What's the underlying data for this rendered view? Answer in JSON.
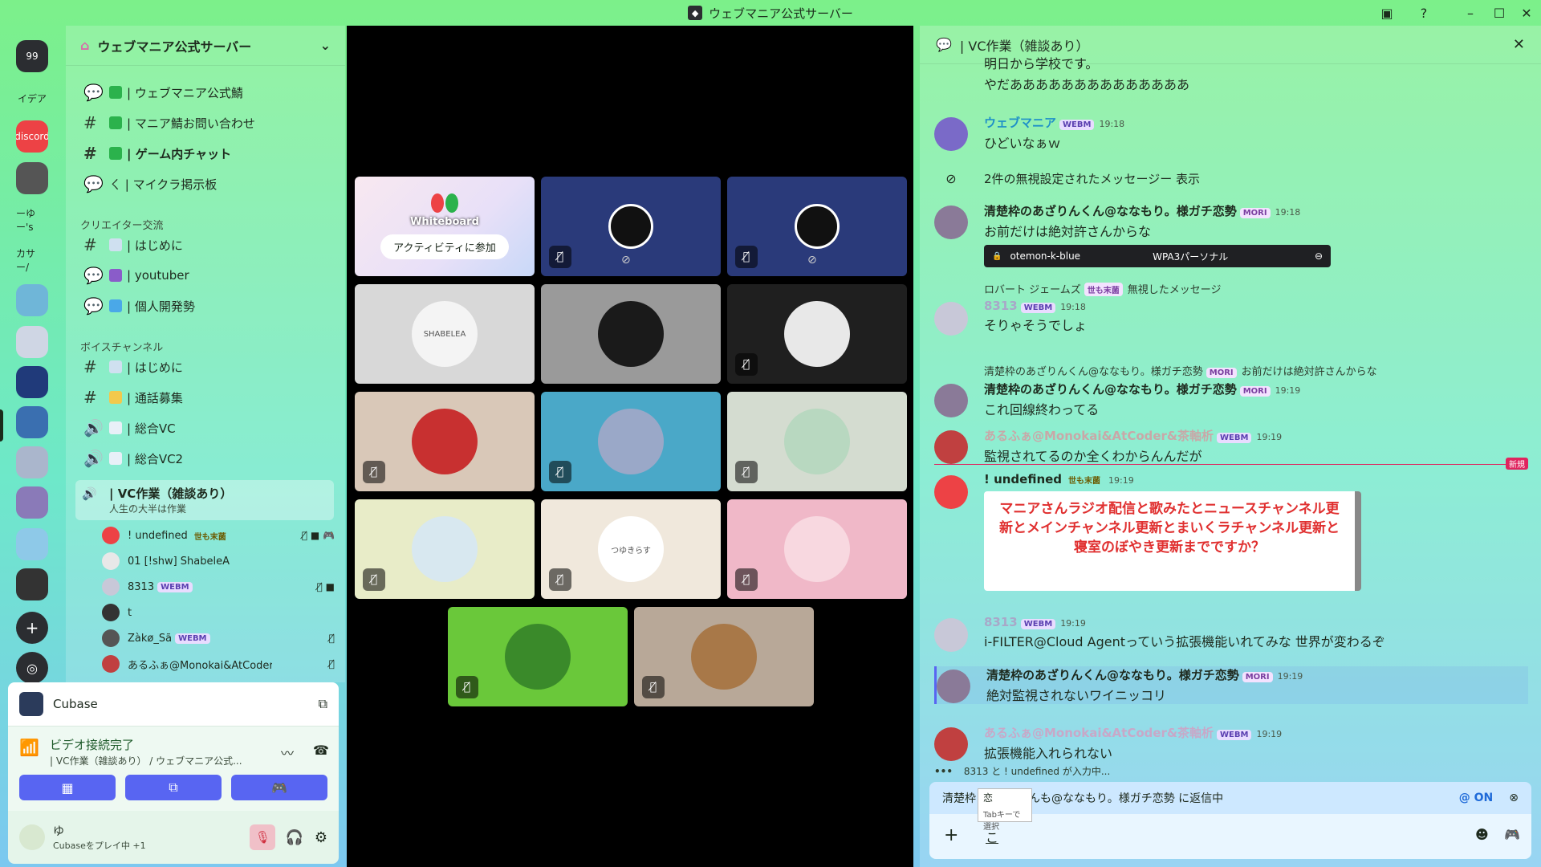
{
  "window": {
    "title": "ウェブマニア公式サーバー"
  },
  "colors": {
    "accent": "#5865f2",
    "discord_red": "#ed4245",
    "new_marker": "#e0245e"
  },
  "rail": {
    "items": [
      {
        "label": "99",
        "bg": "#2b2d31"
      },
      {
        "label": "イデア",
        "bg": "transparent"
      },
      {
        "label": "discord",
        "bg": "#ed4245"
      },
      {
        "label": "",
        "bg": "#555"
      },
      {
        "label": "ーゆー's",
        "bg": "transparent"
      },
      {
        "label": "カサー/",
        "bg": "transparent"
      },
      {
        "label": "",
        "bg": "#6fb6d8"
      },
      {
        "label": "",
        "bg": "#cfd6e4"
      },
      {
        "label": "",
        "bg": "#203a7a"
      },
      {
        "label": "",
        "bg": "#3a6fb0"
      },
      {
        "label": "",
        "bg": "#aab6cc"
      },
      {
        "label": "",
        "bg": "#8a7ab8"
      },
      {
        "label": "",
        "bg": "#8ec9e8"
      },
      {
        "label": "",
        "bg": "#333"
      }
    ]
  },
  "server": {
    "name": "ウェブマニア公式サーバー",
    "channels_top": [
      {
        "label": "| ウェブマニア公式鯖",
        "type": "forum",
        "emoji_color": "#2bb24c"
      },
      {
        "label": "| マニア鯖お問い合わせ",
        "type": "text",
        "emoji_color": "#2bb24c"
      },
      {
        "label": "| ゲーム内チャット",
        "type": "text",
        "emoji_color": "#2bb24c",
        "bold": true
      },
      {
        "label": "ㄑ | マイクラ掲示板",
        "type": "forum",
        "emoji_color": ""
      }
    ],
    "category_creator": "クリエイター交流",
    "channels_creator": [
      {
        "label": "| はじめに",
        "type": "text",
        "emoji_color": "#cfe0f0"
      },
      {
        "label": "| youtuber",
        "type": "forum",
        "emoji_color": "#8a5cc9"
      },
      {
        "label": "| 個人開発勢",
        "type": "forum",
        "emoji_color": "#4aa8e8"
      }
    ],
    "category_voice": "ボイスチャンネル",
    "channels_voice": [
      {
        "label": "| はじめに",
        "type": "text",
        "emoji_color": "#cfe0f0"
      },
      {
        "label": "| 通話募集",
        "type": "text",
        "emoji_color": "#f2c94c"
      },
      {
        "label": "| 総合VC",
        "type": "voice",
        "emoji_color": "#e8f0f8"
      },
      {
        "label": "| 総合VC2",
        "type": "voice",
        "emoji_color": "#e8f0f8"
      }
    ],
    "active_vc": {
      "label": "| VC作業（雑談あり）",
      "status": "人生の大半は作業"
    },
    "vc_users": [
      {
        "name": "! undefined",
        "badge": "世も末菌",
        "badge_type": "yo",
        "av": "#ed4245",
        "icons": "🎙̸ ■ 🎮"
      },
      {
        "name": "01 [!shw] ShabeleA",
        "badge": "",
        "badge_type": "",
        "av": "#e8e8e8",
        "icons": ""
      },
      {
        "name": "8313",
        "badge": "WEBM",
        "badge_type": "webm",
        "av": "#c8c8d8",
        "icons": "🎙̸ ■"
      },
      {
        "name": "t",
        "badge": "",
        "badge_type": "",
        "av": "#333",
        "icons": ""
      },
      {
        "name": "Zàkø_Sã",
        "badge": "WEBM",
        "badge_type": "webm",
        "av": "#555",
        "icons": "🎙̸"
      },
      {
        "name": "あるふぁ@Monokai&AtCoder&茶軸...",
        "badge": "",
        "badge_type": "",
        "av": "#c04040",
        "icons": "🎙̸"
      }
    ]
  },
  "activity": {
    "name": "Cubase"
  },
  "voice_panel": {
    "status": "ビデオ接続完了",
    "location": "| VC作業（雑談あり） / ウェブマニア公式..."
  },
  "user_panel": {
    "name": "ゆ",
    "activity": "Cubaseをプレイ中 +1"
  },
  "stage": {
    "whiteboard_label": "Whiteboard",
    "join_activity": "アクティビティに参加",
    "tiles": [
      {
        "bg": "#2a3a7a",
        "kind": "obs"
      },
      {
        "bg": "#2a3a7a",
        "kind": "obs"
      },
      {
        "bg": "#d8d8d8",
        "ava": "#f4f4f4",
        "kind": "avatar",
        "label": "SHABELEA"
      },
      {
        "bg": "#9a9a9a",
        "ava": "#1a1a1a",
        "kind": "avatar",
        "label": ""
      },
      {
        "bg": "#1f1f1f",
        "ava": "#e8e8e8",
        "kind": "avatar",
        "label": ""
      },
      {
        "bg": "#d9c8b8",
        "ava": "#c83030",
        "kind": "avatar",
        "label": ""
      },
      {
        "bg": "#4aa8c8",
        "ava": "#9aa8c8",
        "kind": "avatar",
        "label": ""
      },
      {
        "bg": "#d4dcd0",
        "ava": "#b8d8c0",
        "kind": "avatar",
        "label": ""
      },
      {
        "bg": "#e8ecc8",
        "ava": "#d8e8f0",
        "kind": "avatar",
        "label": ""
      },
      {
        "bg": "#f0e8dc",
        "ava": "#ffffff",
        "kind": "avatar",
        "label": "つゆきらす"
      },
      {
        "bg": "#f0b8c8",
        "ava": "#f8d8e0",
        "kind": "avatar",
        "label": ""
      },
      {
        "bg": "#6ac83a",
        "ava": "#3a8a2a",
        "kind": "avatar",
        "label": ""
      },
      {
        "bg": "#b8a898",
        "ava": "#a87848",
        "kind": "avatar",
        "label": ""
      }
    ]
  },
  "chat": {
    "header": "| VC作業（雑談あり）",
    "messages": [
      {
        "kind": "cont",
        "text1": "明日から学校です。",
        "text2": "やだああああああああああああああ"
      },
      {
        "kind": "msg",
        "name": "ウェブマニア",
        "name_color": "#1e90c8",
        "badge": "WEBM",
        "badge_type": "webm",
        "time": "19:18",
        "text": "ひどいなぁｗ",
        "av": "#7a6ac8"
      },
      {
        "kind": "blocked",
        "text": "2件の無視設定されたメッセージー 表示"
      },
      {
        "kind": "msg",
        "name": "清楚枠のあざりんくん@ななもり。様ガチ恋勢",
        "name_color": "#1e2a1e",
        "badge": "MORI",
        "badge_type": "mori",
        "time": "19:18",
        "text": "お前だけは絶対許さんからな",
        "av": "#8a7a98",
        "wifi_name": "otemon-k-blue",
        "wifi_sec": "WPA3パーソナル"
      },
      {
        "kind": "msg",
        "reply_name": "ロバート ジェームズ",
        "reply_badge": "世も末菌",
        "reply_text": "無視したメッセージ",
        "name": "8313",
        "name_color": "#a8a8c8",
        "badge": "WEBM",
        "badge_type": "webm",
        "time": "19:18",
        "text": "そりゃそうでしょ",
        "av": "#c8c8d8"
      },
      {
        "kind": "msg",
        "reply_name": "清楚枠のあざりんくん@ななもり。様ガチ恋勢",
        "reply_badge": "MORI",
        "reply_text": "お前だけは絶対許さんからな",
        "name": "清楚枠のあざりんくん@ななもり。様ガチ恋勢",
        "name_color": "#1e2a1e",
        "badge": "MORI",
        "badge_type": "mori",
        "time": "19:19",
        "text": "これ回線終わってる",
        "av": "#8a7a98"
      },
      {
        "kind": "msg",
        "name": "あるふぁ@Monokai&AtCoder&茶軸析",
        "name_color": "#c8a8a8",
        "badge": "WEBM",
        "badge_type": "webm",
        "time": "19:19",
        "text": "監視されてるのか全くわからんんだが",
        "av": "#c04040"
      },
      {
        "kind": "newline",
        "label": "新規"
      },
      {
        "kind": "msg",
        "name": "! undefined",
        "name_color": "#1e2a1e",
        "badge": "世も末菌",
        "badge_type": "yo",
        "time": "19:19",
        "text": "",
        "av": "#ed4245",
        "image_text": "マニアさんラジオ配信と歌みたとニュースチャンネル更新とメインチャンネル更新とまいくラチャンネル更新と寝室のぼやき更新までですか？"
      },
      {
        "kind": "msg",
        "name": "8313",
        "name_color": "#a8a8c8",
        "badge": "WEBM",
        "badge_type": "webm",
        "time": "19:19",
        "text": "i-FILTER@Cloud Agentっていう拡張機能いれてみな 世界が変わるぞ",
        "av": "#c8c8d8"
      },
      {
        "kind": "msg",
        "name": "清楚枠のあざりんくん@ななもり。様ガチ恋勢",
        "name_color": "#1e2a1e",
        "badge": "MORI",
        "badge_type": "mori",
        "time": "19:19",
        "text": "絶対監視されないワイニッコリ",
        "av": "#8a7a98",
        "highlight": true
      },
      {
        "kind": "msg",
        "name": "あるふぁ@Monokai&AtCoder&茶軸析",
        "name_color": "#c8a8c8",
        "badge": "WEBM",
        "badge_type": "webm",
        "time": "19:19",
        "text": "拡張機能入れられない",
        "av": "#c04040"
      }
    ],
    "typing": "8313 と ! undefined が入力中...",
    "reply_to_prefix": "清楚枠",
    "reply_to_suffix": "んも@ななもり。様ガチ恋勢 に返信中",
    "mention": "@ ON",
    "input_value": "こ",
    "ime_candidate": "恋",
    "ime_hint": "Tabキーで選択"
  }
}
